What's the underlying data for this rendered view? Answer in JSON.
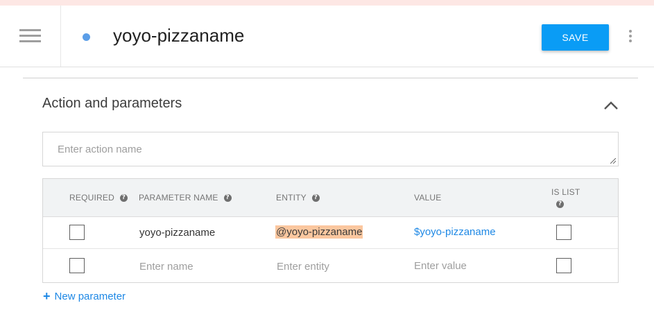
{
  "header": {
    "intent_name": "yoyo-pizzaname",
    "save_label": "SAVE",
    "status_color": "#5b9ee8",
    "accent_color": "#0a9cf5"
  },
  "section": {
    "title": "Action and parameters",
    "action_placeholder": "Enter action name"
  },
  "table": {
    "headers": {
      "required": "REQUIRED",
      "parameter_name": "PARAMETER NAME",
      "entity": "ENTITY",
      "value": "VALUE",
      "is_list": "IS LIST"
    },
    "help_glyph": "?",
    "rows": [
      {
        "required": false,
        "parameter_name": "yoyo-pizzaname",
        "entity": "@yoyo-pizzaname",
        "value": "$yoyo-pizzaname",
        "is_list": false
      }
    ],
    "new_row": {
      "name_placeholder": "Enter name",
      "entity_placeholder": "Enter entity",
      "value_placeholder": "Enter value"
    }
  },
  "footer": {
    "plus_glyph": "+",
    "new_parameter_label": "New parameter"
  }
}
